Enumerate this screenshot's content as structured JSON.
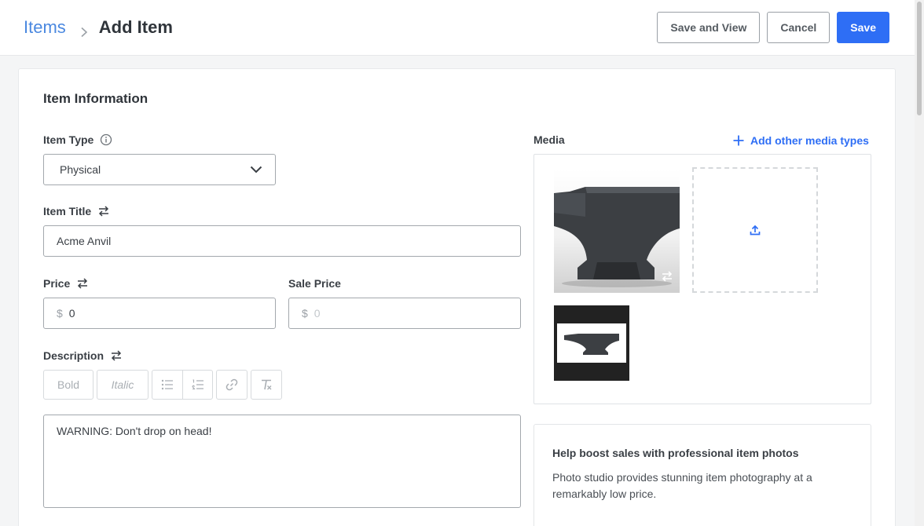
{
  "header": {
    "breadcrumb_root": "Items",
    "breadcrumb_current": "Add Item",
    "save_and_view_label": "Save and View",
    "cancel_label": "Cancel",
    "save_label": "Save"
  },
  "form": {
    "section_title": "Item Information",
    "item_type": {
      "label": "Item Type",
      "value": "Physical"
    },
    "item_title": {
      "label": "Item Title",
      "value": "Acme Anvil"
    },
    "price": {
      "label": "Price",
      "currency": "$",
      "value": "0"
    },
    "sale_price": {
      "label": "Sale Price",
      "currency": "$",
      "placeholder": "0"
    },
    "description": {
      "label": "Description",
      "toolbar": {
        "bold": "Bold",
        "italic": "Italic"
      },
      "value": "WARNING: Don't drop on head!"
    }
  },
  "media": {
    "label": "Media",
    "add_other_label": "Add other media types"
  },
  "promo": {
    "title": "Help boost sales with professional item photos",
    "text": "Photo studio provides stunning item photography at a remarkably low price."
  },
  "colors": {
    "accent": "#2e6ef5",
    "link": "#4a88e0"
  },
  "icons": [
    "chevron-right-icon",
    "info-icon",
    "chevron-down-icon",
    "swap-icon",
    "bullet-list-icon",
    "numbered-list-icon",
    "link-icon",
    "clear-format-icon",
    "plus-icon",
    "upload-icon"
  ]
}
